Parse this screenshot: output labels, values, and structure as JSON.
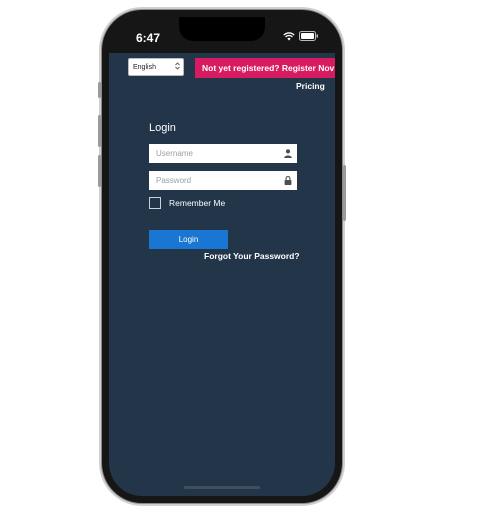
{
  "status_bar": {
    "time": "6:47",
    "icons": [
      "wifi-icon",
      "battery-icon"
    ]
  },
  "language_select": {
    "selected": "English",
    "chevron": "⌃"
  },
  "register_banner": {
    "text": "Not yet registered? Register Nov",
    "color": "#d81b60"
  },
  "pricing_link": "Pricing",
  "login_form": {
    "heading": "Login",
    "username_placeholder": "Username",
    "username_icon": "user-icon",
    "password_placeholder": "Password",
    "password_icon": "lock-icon",
    "remember_label": "Remember Me",
    "login_button_label": "Login",
    "forgot_link": "Forgot Your Password?"
  },
  "colors": {
    "screen_bg": "#223549",
    "button": "#1976d2",
    "banner": "#d81b60"
  }
}
